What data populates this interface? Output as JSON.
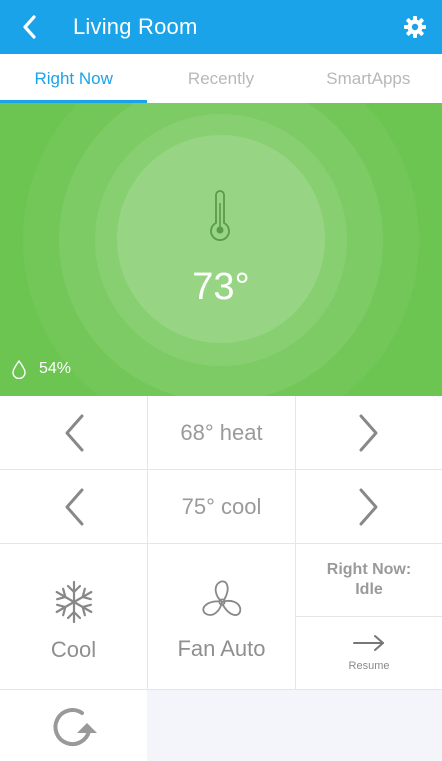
{
  "header": {
    "title": "Living Room",
    "back_icon": "chevron-left-icon",
    "settings_icon": "gear-icon"
  },
  "tabs": [
    {
      "label": "Right Now",
      "active": true
    },
    {
      "label": "Recently",
      "active": false
    },
    {
      "label": "SmartApps",
      "active": false
    }
  ],
  "hero": {
    "temperature": "73°",
    "humidity": "54%",
    "icon": "thermometer-icon"
  },
  "controls": {
    "heat_setpoint": "68° heat",
    "cool_setpoint": "75° cool",
    "mode_label": "Cool",
    "mode_icon": "snowflake-icon",
    "fan_label": "Fan Auto",
    "fan_icon": "fan-icon",
    "status_title": "Right Now:",
    "status_value": "Idle",
    "resume_label": "Resume",
    "refresh_icon": "refresh-icon"
  },
  "colors": {
    "accent": "#1aa3e8",
    "hero_green": "#6cc551",
    "text_gray": "#9a9a9a"
  }
}
